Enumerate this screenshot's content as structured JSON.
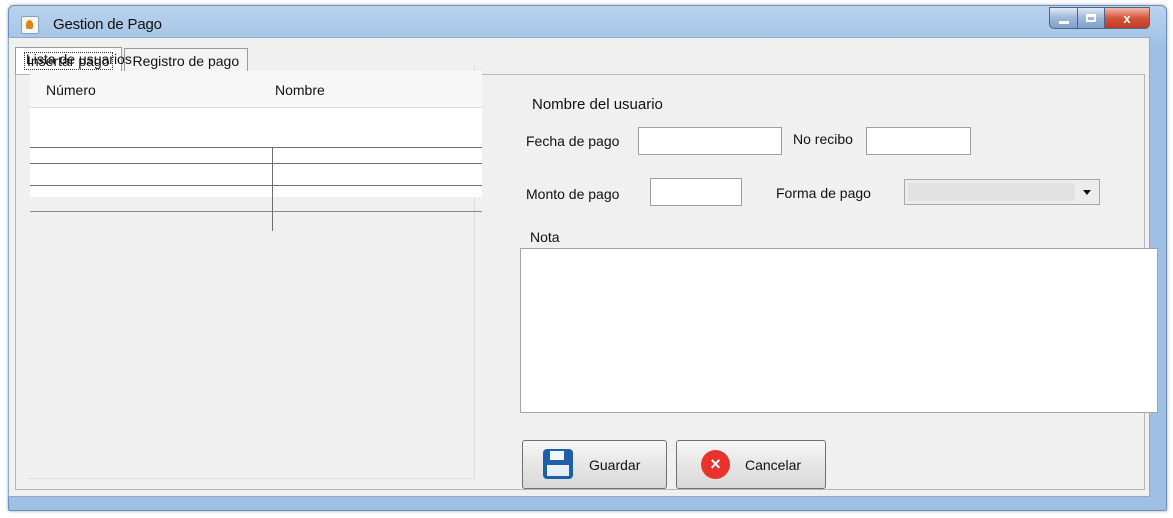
{
  "window": {
    "title": "Gestion de Pago",
    "controls": {
      "close": "x"
    }
  },
  "tabs": [
    {
      "label": "Insertar pago",
      "active": true
    },
    {
      "label": "Registro de pago",
      "active": false
    }
  ],
  "user_list": {
    "label": "Lista de usuarios",
    "columns": [
      "Número",
      "Nombre"
    ]
  },
  "form": {
    "user_name_label": "Nombre del usuario",
    "fecha_label": "Fecha de pago",
    "fecha_value": "",
    "recibo_label": "No recibo",
    "recibo_value": "",
    "monto_label": "Monto de pago",
    "monto_value": "",
    "forma_label": "Forma de pago",
    "forma_value": "",
    "nota_label": "Nota",
    "nota_value": ""
  },
  "buttons": {
    "save_label": "Guardar",
    "cancel_label": "Cancelar",
    "cancel_glyph": "×"
  },
  "colors": {
    "titlebar": "#a9c6e8",
    "close_button": "#d4553e",
    "save_icon": "#1f5fa8",
    "cancel_icon": "#e8322b"
  }
}
